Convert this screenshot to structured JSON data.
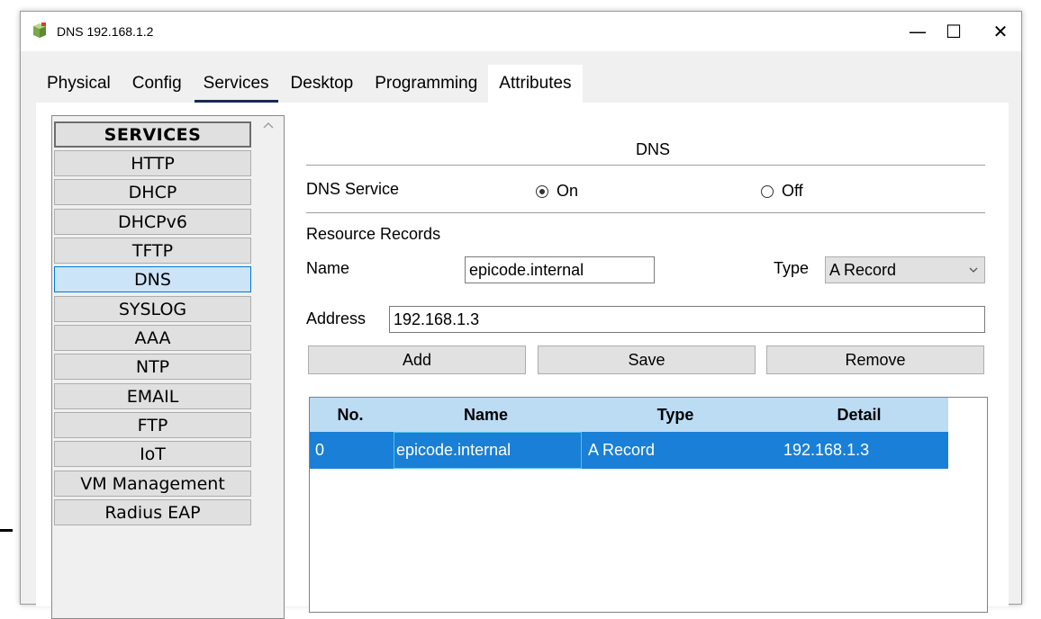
{
  "window": {
    "title": "DNS 192.168.1.2",
    "controls": {
      "minimize": "—",
      "maximize": "☐",
      "close": "✕"
    }
  },
  "tabs": [
    "Physical",
    "Config",
    "Services",
    "Desktop",
    "Programming",
    "Attributes"
  ],
  "active_tab": "Services",
  "sidebar": {
    "header": "SERVICES",
    "items": [
      "HTTP",
      "DHCP",
      "DHCPv6",
      "TFTP",
      "DNS",
      "SYSLOG",
      "AAA",
      "NTP",
      "EMAIL",
      "FTP",
      "IoT",
      "VM Management",
      "Radius EAP"
    ],
    "selected": "DNS"
  },
  "dns": {
    "title": "DNS",
    "service_label": "DNS Service",
    "on_label": "On",
    "off_label": "Off",
    "service_state": "On",
    "resource_records_label": "Resource Records",
    "name_label": "Name",
    "name_value": "epicode.internal",
    "type_label": "Type",
    "type_value": "A Record",
    "address_label": "Address",
    "address_value": "192.168.1.3",
    "buttons": {
      "add": "Add",
      "save": "Save",
      "remove": "Remove"
    },
    "table": {
      "columns": [
        "No.",
        "Name",
        "Type",
        "Detail"
      ],
      "rows": [
        {
          "no": "0",
          "name": "epicode.internal",
          "type": "A Record",
          "detail": "192.168.1.3"
        }
      ]
    }
  },
  "colors": {
    "selected_row": "#1a7fd6",
    "table_header": "#bcdcf4",
    "sidebar_selected": "#cce4f7",
    "active_tab_underline": "#1a2a52"
  },
  "icons": {
    "app": "packet-tracer-server-icon",
    "scroll_up": "chevron-up-icon",
    "dropdown": "chevron-down-icon"
  }
}
